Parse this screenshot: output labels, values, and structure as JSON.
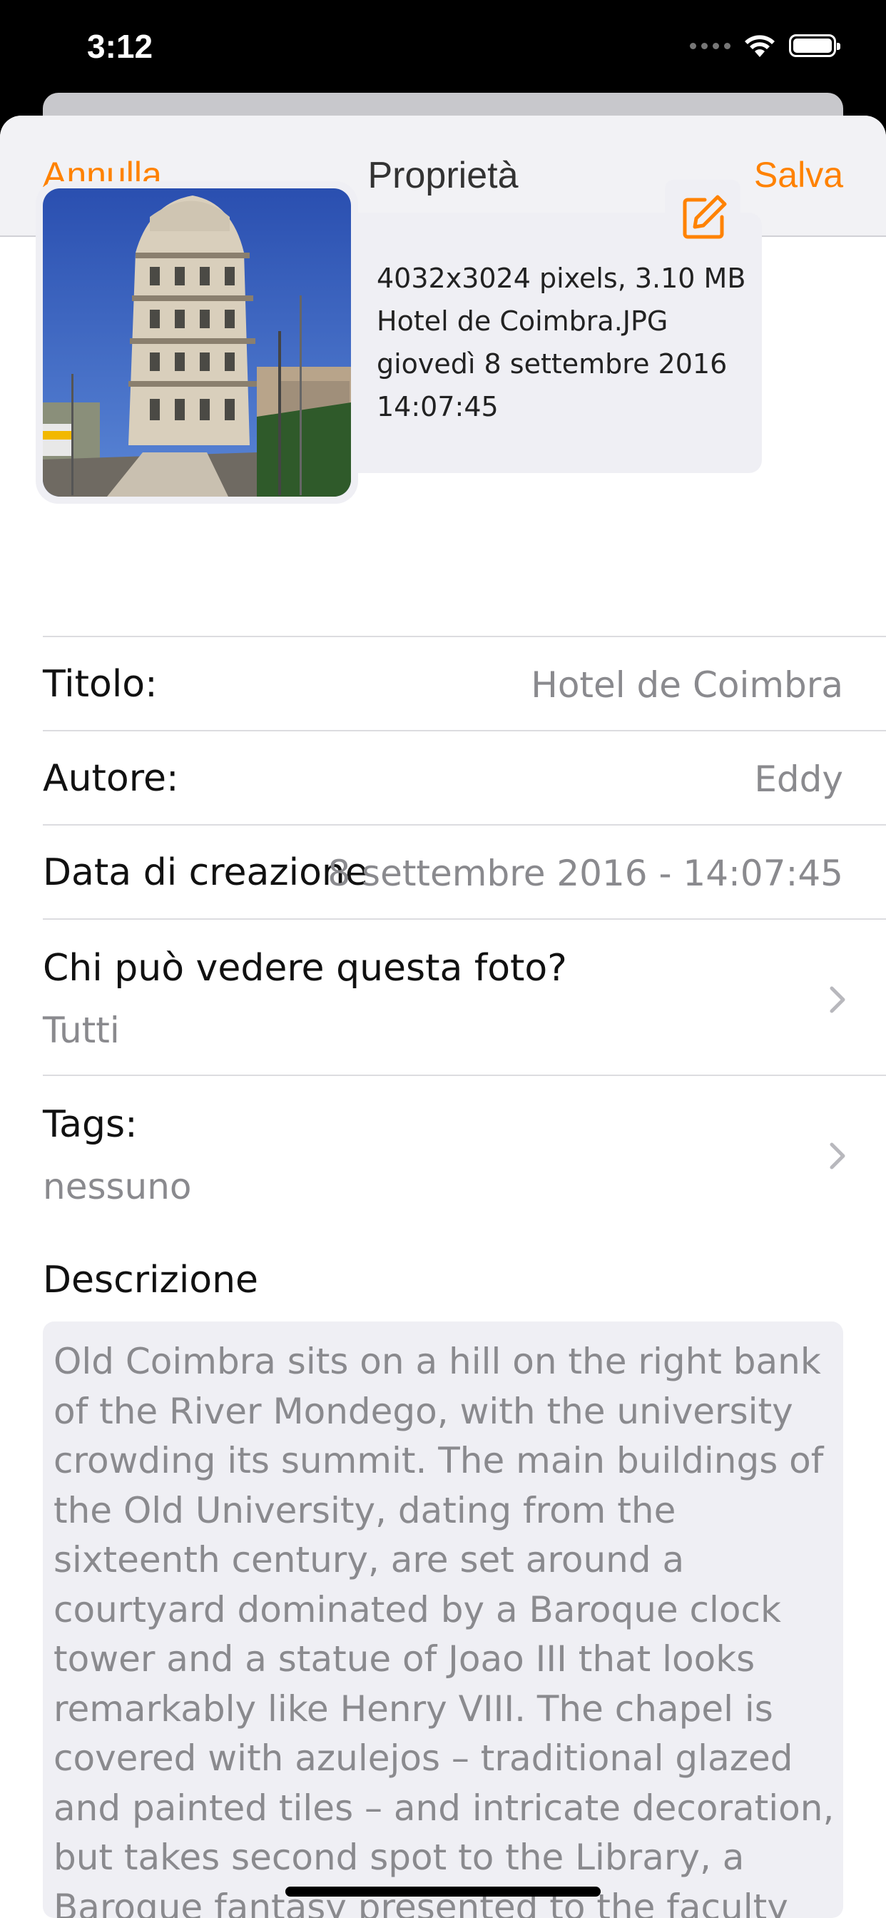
{
  "status": {
    "time": "3:12"
  },
  "nav": {
    "cancel": "Annulla",
    "title": "Proprietà",
    "save": "Salva"
  },
  "photo": {
    "info_lines": [
      "4032x3024 pixels, 3.10 MB",
      "Hotel de Coimbra.JPG",
      "giovedì 8 settembre 2016",
      "14:07:45"
    ]
  },
  "fields": {
    "title_label": "Titolo:",
    "title_value": "Hotel de Coimbra",
    "author_label": "Autore:",
    "author_value": "Eddy",
    "created_label": "Data di creazione",
    "created_value": "8 settembre 2016 - 14:07:45",
    "visibility_label": "Chi può vedere questa foto?",
    "visibility_value": "Tutti",
    "tags_label": "Tags:",
    "tags_value": "nessuno",
    "description_label": "Descrizione",
    "description_text": "Old Coimbra sits on a hill on the right bank of the River Mondego, with the university crowding its summit. The main buildings of the Old University, dating from the sixteenth century, are set around a courtyard dominated by a Baroque clock tower and a statue of Joao III that looks remarkably like Henry VIII. The chapel is covered with azulejos – traditional glazed and painted tiles – and intricate decoration, but takes second spot to the Library, a Baroque fantasy presented to the faculty by Joao V in the early eighteenth"
  },
  "colors": {
    "accent": "#ff8200",
    "sheet_bg": "#ffffff",
    "field_bg": "#efeff4",
    "secondary_text": "#8a8a8e"
  },
  "icons": [
    "wifi-icon",
    "battery-icon",
    "edit-icon",
    "chevron-right-icon"
  ]
}
